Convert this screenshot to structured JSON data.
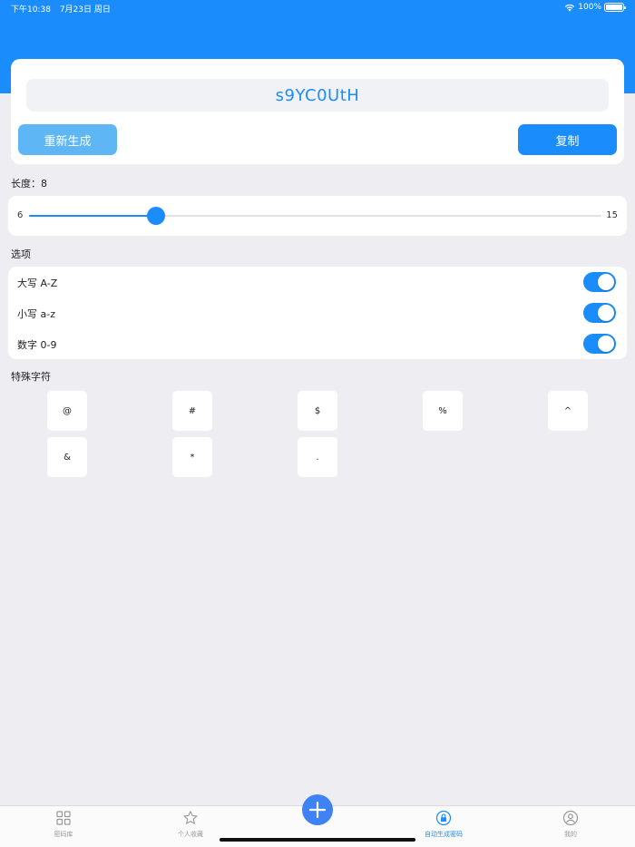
{
  "status_bar": {
    "time": "下午10:38",
    "date": "7月23日 周日",
    "battery": "100%"
  },
  "password": {
    "value": "s9YC0UtH",
    "regenerate_label": "重新生成",
    "copy_label": "复制"
  },
  "length": {
    "label": "长度：8",
    "min": "6",
    "max": "15",
    "value": 8
  },
  "options": {
    "title": "选项",
    "items": [
      {
        "label": "大写 A-Z",
        "enabled": true
      },
      {
        "label": "小写 a-z",
        "enabled": true
      },
      {
        "label": "数字 0-9",
        "enabled": true
      }
    ]
  },
  "special": {
    "title": "特殊字符",
    "chars": [
      "@",
      "#",
      "$",
      "%",
      "^",
      "&",
      "*",
      "."
    ]
  },
  "tab_bar": {
    "items": [
      {
        "label": "密码库",
        "icon": "grid-icon"
      },
      {
        "label": "个人收藏",
        "icon": "star-icon"
      },
      {
        "label": "自动生成密码",
        "icon": "lock-icon"
      },
      {
        "label": "我的",
        "icon": "person-icon"
      }
    ],
    "active_index": 2,
    "add_icon": "plus-icon"
  },
  "colors": {
    "accent": "#1a8cfb",
    "accent_light": "#5fb6f5",
    "background": "#eeedf2"
  }
}
